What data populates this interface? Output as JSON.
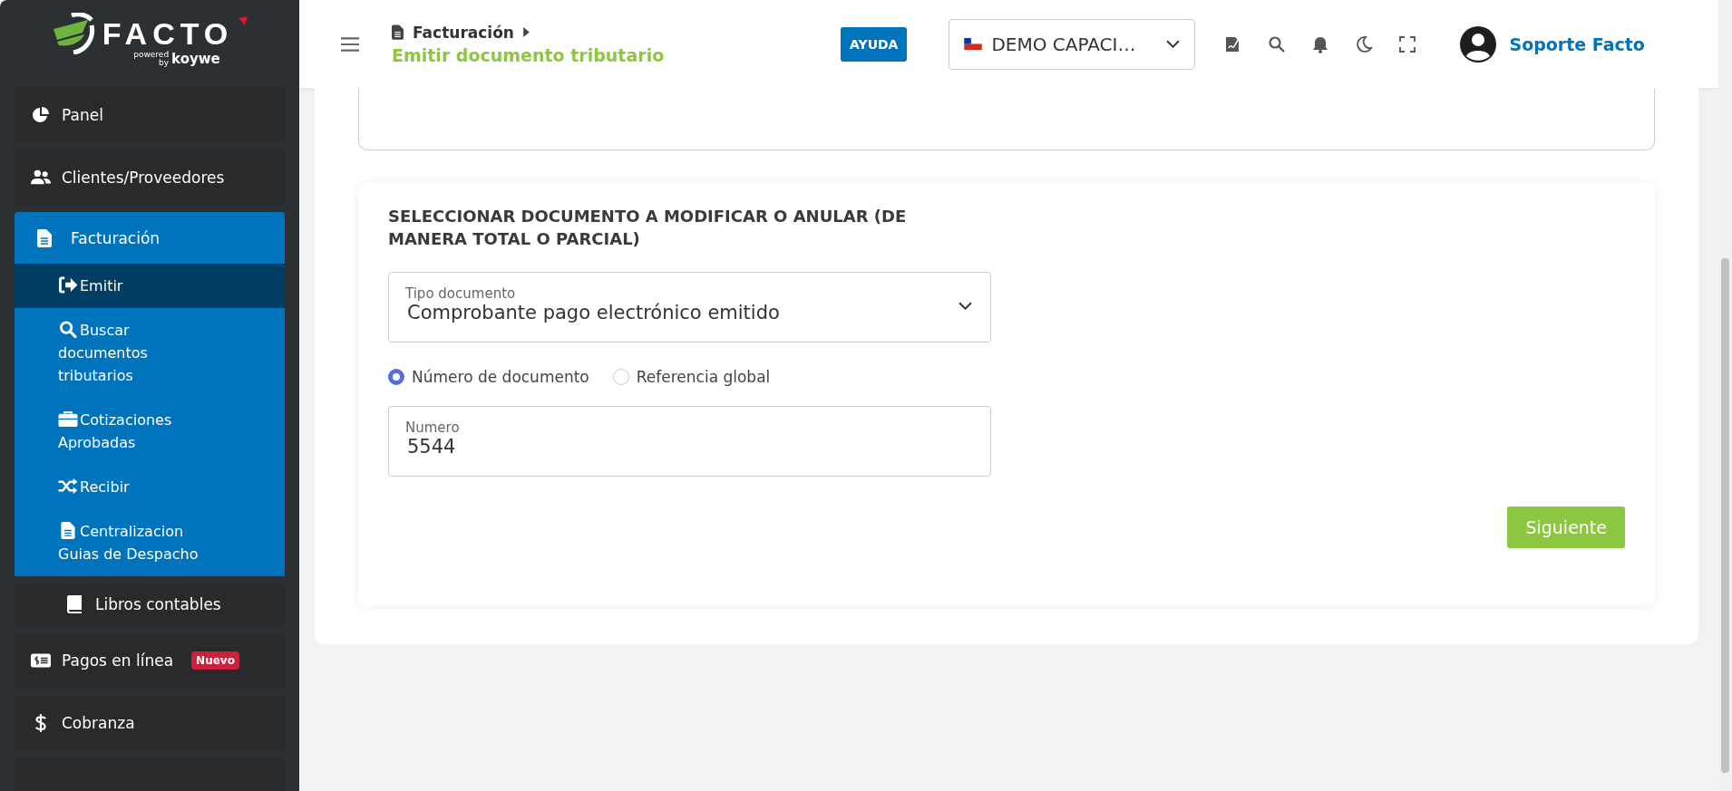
{
  "brand": {
    "name": "FACTO",
    "powered": "powered",
    "by": "by",
    "partner": "koywe"
  },
  "sidebar": {
    "items": [
      {
        "kind": "item",
        "label": "Panel"
      },
      {
        "kind": "item",
        "label": "Clientes/Proveedores"
      },
      {
        "kind": "group",
        "label": "Facturación",
        "expanded": true,
        "children": [
          {
            "label": "Emitir",
            "selected": true
          },
          {
            "label": "Buscar documentos tributarios",
            "selected": false
          },
          {
            "label": "Cotizaciones Aprobadas",
            "selected": false
          },
          {
            "label": "Recibir",
            "selected": false
          },
          {
            "label": "Centralizacion Guias de Despacho",
            "selected": false
          }
        ]
      },
      {
        "kind": "subitem",
        "label": "Libros contables"
      },
      {
        "kind": "item",
        "label": "Pagos en línea",
        "badge": "Nuevo"
      },
      {
        "kind": "item",
        "label": "Cobranza"
      },
      {
        "kind": "blank"
      }
    ]
  },
  "header": {
    "breadcrumb": "Facturación",
    "page_title": "Emitir documento tributario",
    "help_button": "AYUDA",
    "company_select": "DEMO CAPACI…",
    "user": "Soporte Facto"
  },
  "form": {
    "title": "SELECCIONAR DOCUMENTO A MODIFICAR O ANULAR (DE MANERA TOTAL O PARCIAL)",
    "document_type": {
      "label": "Tipo documento",
      "value": "Comprobante pago electrónico emitido"
    },
    "options": [
      {
        "label": "Número de documento",
        "selected": true
      },
      {
        "label": "Referencia global",
        "selected": false
      }
    ],
    "number": {
      "label": "Numero",
      "value": "5544"
    },
    "next_button": "Siguiente"
  }
}
